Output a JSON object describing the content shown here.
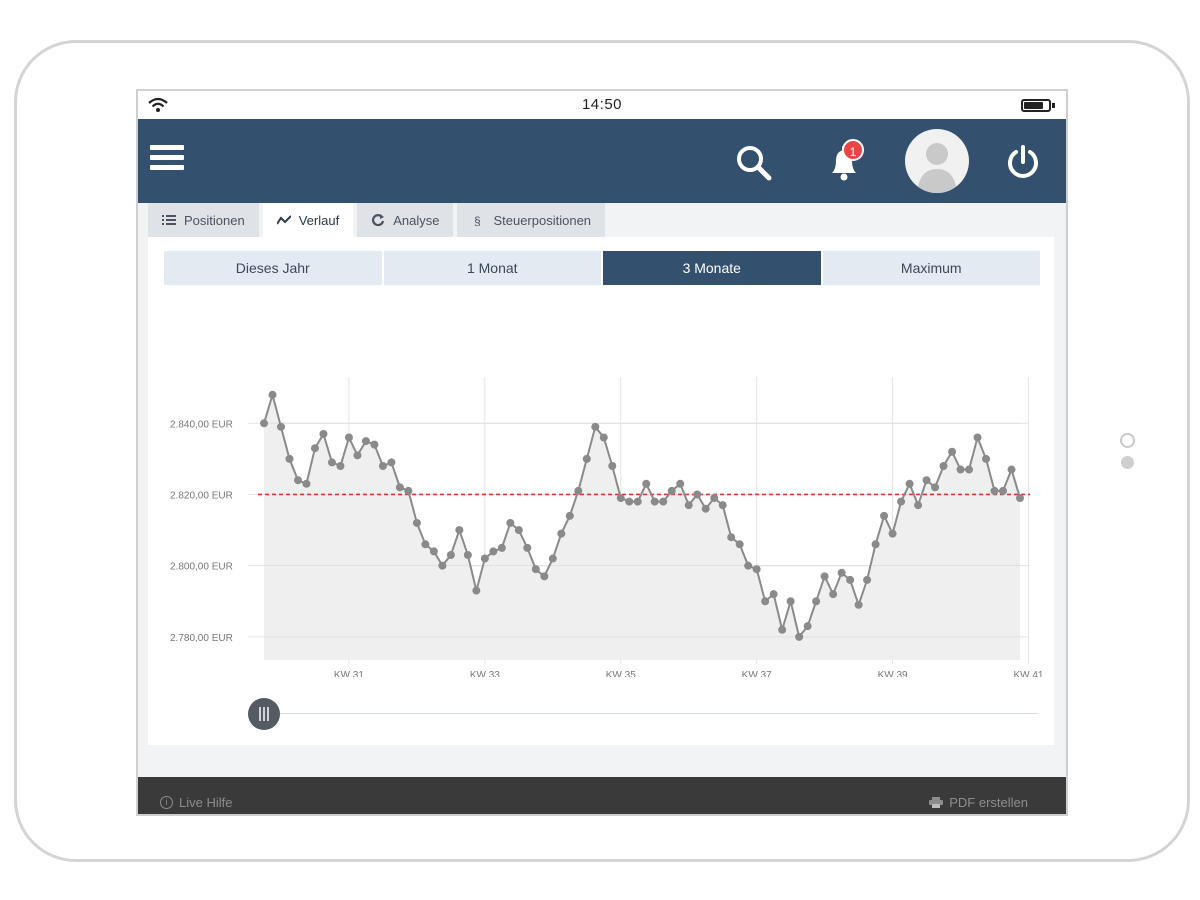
{
  "status_bar": {
    "time": "14:50",
    "battery_level": 0.8
  },
  "header": {
    "menu_icon": "hamburger-icon",
    "search_icon": "search-icon",
    "notifications": {
      "icon": "bell-icon",
      "count": "1"
    },
    "avatar_icon": "user-avatar-icon",
    "power_icon": "power-icon",
    "background_color": "#34506f"
  },
  "tabs": [
    {
      "label": "Positionen",
      "icon": "list-icon",
      "active": false
    },
    {
      "label": "Verlauf",
      "icon": "trend-icon",
      "active": true
    },
    {
      "label": "Analyse",
      "icon": "refresh-icon",
      "active": false
    },
    {
      "label": "Steuerpositionen",
      "icon": "paragraph-icon",
      "active": false
    }
  ],
  "ranges": [
    {
      "label": "Dieses Jahr",
      "active": false
    },
    {
      "label": "1 Monat",
      "active": false
    },
    {
      "label": "3 Monate",
      "active": true
    },
    {
      "label": "Maximum",
      "active": false
    }
  ],
  "chart_data": {
    "type": "line",
    "title": "",
    "xlabel": "",
    "ylabel": "",
    "ytick_labels": [
      "2.840,00 EUR",
      "2.820,00 EUR",
      "2.800,00 EUR",
      "2.780,00 EUR"
    ],
    "yticks": [
      2840,
      2820,
      2800,
      2780
    ],
    "ylim": [
      2773.5,
      2853
    ],
    "x_ticks": [
      {
        "label": "KW 31",
        "index": 10
      },
      {
        "label": "KW 33",
        "index": 26
      },
      {
        "label": "KW 35",
        "index": 42
      },
      {
        "label": "KW 37",
        "index": 58
      },
      {
        "label": "KW 39",
        "index": 74
      },
      {
        "label": "KW 41",
        "index": 90
      }
    ],
    "reference_line": {
      "value": 2820,
      "color": "#e0332f",
      "style": "dashed"
    },
    "series_color": "#8a8a8a",
    "area_fill": "#efefef",
    "grid": true,
    "values": [
      2840,
      2848,
      2839,
      2830,
      2824,
      2823,
      2833,
      2837,
      2829,
      2828,
      2836,
      2831,
      2835,
      2834,
      2828,
      2829,
      2822,
      2821,
      2812,
      2806,
      2804,
      2800,
      2803,
      2810,
      2803,
      2793,
      2802,
      2804,
      2805,
      2812,
      2810,
      2805,
      2799,
      2797,
      2802,
      2809,
      2814,
      2821,
      2830,
      2839,
      2836,
      2828,
      2819,
      2818,
      2818,
      2823,
      2818,
      2818,
      2821,
      2823,
      2817,
      2820,
      2816,
      2819,
      2817,
      2808,
      2806,
      2800,
      2799,
      2790,
      2792,
      2782,
      2790,
      2780,
      2783,
      2790,
      2797,
      2792,
      2798,
      2796,
      2789,
      2796,
      2806,
      2814,
      2809,
      2818,
      2823,
      2817,
      2824,
      2822,
      2828,
      2832,
      2827,
      2827,
      2836,
      2830,
      2821,
      2821,
      2827,
      2819
    ]
  },
  "slider": {
    "position": 0
  },
  "footer": {
    "help_label": "Live Hilfe",
    "help_icon": "info-icon",
    "pdf_label": "PDF erstellen",
    "pdf_icon": "printer-icon",
    "background_color": "#3a3a3a"
  }
}
